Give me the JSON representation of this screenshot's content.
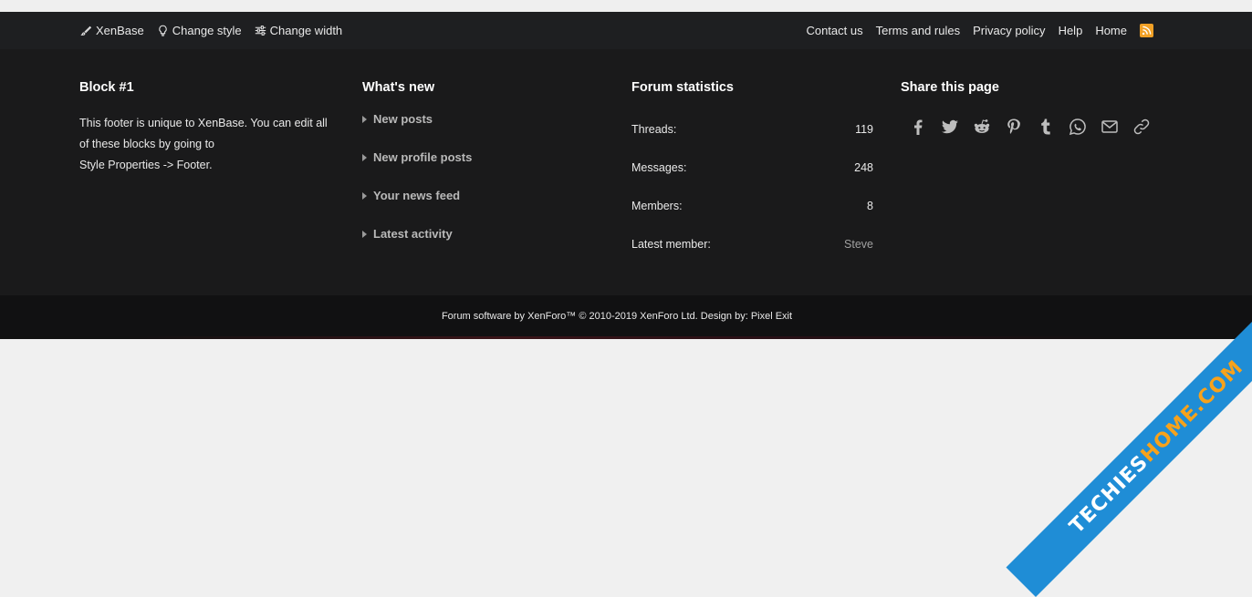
{
  "nav_left": [
    {
      "label": "XenBase",
      "icon": "brush-icon"
    },
    {
      "label": "Change style",
      "icon": "lightbulb-icon"
    },
    {
      "label": "Change width",
      "icon": "sliders-icon"
    }
  ],
  "nav_right": [
    "Contact us",
    "Terms and rules",
    "Privacy policy",
    "Help",
    "Home"
  ],
  "block1": {
    "title": "Block #1",
    "text_line1": "This footer is unique to XenBase. You can edit all",
    "text_line2": "of these blocks by going to",
    "text_line3": "Style Properties -> Footer."
  },
  "whats_new": {
    "title": "What's new",
    "items": [
      "New posts",
      "New profile posts",
      "Your news feed",
      "Latest activity"
    ]
  },
  "forum_stats": {
    "title": "Forum statistics",
    "rows": [
      {
        "label": "Threads:",
        "value": "119"
      },
      {
        "label": "Messages:",
        "value": "248"
      },
      {
        "label": "Members:",
        "value": "8"
      },
      {
        "label": "Latest member:",
        "value": "Steve"
      }
    ]
  },
  "share": {
    "title": "Share this page",
    "icons": [
      "facebook-icon",
      "twitter-icon",
      "reddit-icon",
      "pinterest-icon",
      "tumblr-icon",
      "whatsapp-icon",
      "email-icon",
      "link-icon"
    ]
  },
  "footer": {
    "copyright": "Forum software by XenForo™ © 2010-2019 XenForo Ltd. Design by: Pixel Exit"
  },
  "watermark": {
    "part1": "TECHIES",
    "part2": "HOME.COM"
  },
  "colors": {
    "bar": "#1e1f21",
    "main": "#1a1a1b",
    "footer": "#111112",
    "rss": "#f0a026",
    "ribbon": "#1f8dd6"
  }
}
